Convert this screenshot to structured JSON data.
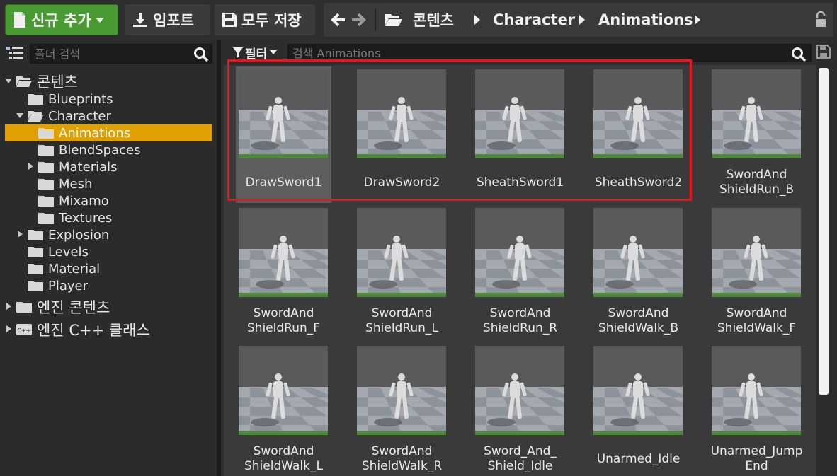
{
  "toolbar": {
    "new_label": "신규 추가",
    "import_label": "임포트",
    "saveall_label": "모두 저장"
  },
  "breadcrumb": [
    "콘텐츠",
    "Character",
    "Animations"
  ],
  "left": {
    "search_placeholder": "폴더 검색",
    "tree": [
      {
        "label": "콘텐츠",
        "expanded": true
      },
      {
        "label": "Blueprints"
      },
      {
        "label": "Character",
        "expanded": true
      },
      {
        "label": "Animations",
        "selected": true
      },
      {
        "label": "BlendSpaces"
      },
      {
        "label": "Materials",
        "has_children": true
      },
      {
        "label": "Mesh"
      },
      {
        "label": "Mixamo"
      },
      {
        "label": "Textures"
      },
      {
        "label": "Explosion",
        "has_children": true
      },
      {
        "label": "Levels"
      },
      {
        "label": "Material"
      },
      {
        "label": "Player"
      },
      {
        "label": "엔진 콘텐츠",
        "has_children": true
      },
      {
        "label": "엔진 C++ 클래스",
        "has_children": true
      }
    ]
  },
  "right": {
    "filter_label": "필터",
    "search_placeholder": "검색 Animations",
    "assets": [
      {
        "line1": "DrawSword1",
        "line2": "",
        "selected": true
      },
      {
        "line1": "DrawSword2",
        "line2": ""
      },
      {
        "line1": "SheathSword1",
        "line2": ""
      },
      {
        "line1": "SheathSword2",
        "line2": ""
      },
      {
        "line1": "SwordAnd",
        "line2": "ShieldRun_B"
      },
      {
        "line1": "SwordAnd",
        "line2": "ShieldRun_F"
      },
      {
        "line1": "SwordAnd",
        "line2": "ShieldRun_L"
      },
      {
        "line1": "SwordAnd",
        "line2": "ShieldRun_R"
      },
      {
        "line1": "SwordAnd",
        "line2": "ShieldWalk_B"
      },
      {
        "line1": "SwordAnd",
        "line2": "ShieldWalk_F"
      },
      {
        "line1": "SwordAnd",
        "line2": "ShieldWalk_L"
      },
      {
        "line1": "SwordAnd",
        "line2": "ShieldWalk_R"
      },
      {
        "line1": "Sword_And_",
        "line2": "Shield_Idle"
      },
      {
        "line1": "Unarmed_Idle",
        "line2": ""
      },
      {
        "line1": "Unarmed_Jump",
        "line2": "End"
      }
    ]
  },
  "colors": {
    "new_button": "#4a9a34",
    "selection": "#e0a000",
    "annotation_box": "#e0191f",
    "thumb_ground_line": "#4f8a3c"
  },
  "icons": [
    "import-icon",
    "save-icon",
    "back-arrow-icon",
    "forward-arrow-icon",
    "folder-open-icon",
    "lock-icon",
    "tree-list-icon",
    "search-icon",
    "filter-icon",
    "save-search-icon",
    "folder-icon",
    "cpp-class-icon"
  ]
}
